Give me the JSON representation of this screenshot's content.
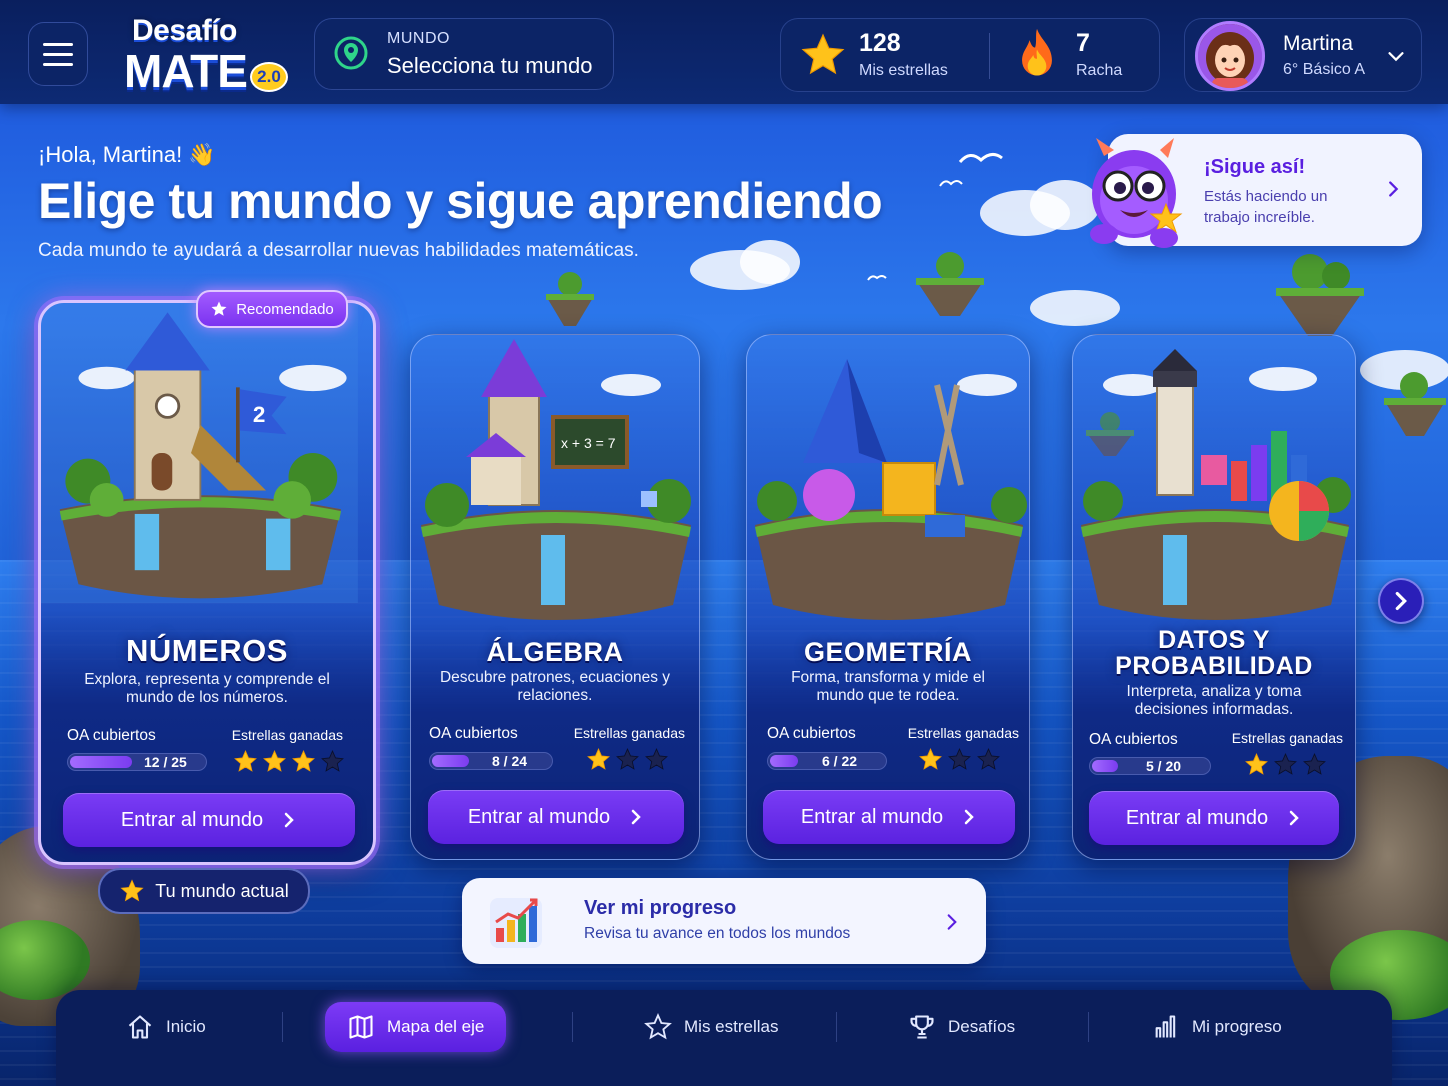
{
  "header": {
    "logo_line1": "Desafío",
    "logo_line2": "MATE",
    "logo_version": "2.0",
    "world_caption": "MUNDO",
    "world_value": "Selecciona tu mundo",
    "stars_count": "128",
    "stars_label": "Mis estrellas",
    "streak_count": "7",
    "streak_label": "Racha",
    "user_name": "Martina",
    "user_grade": "6° Básico A"
  },
  "greeting": {
    "hello": "¡Hola, Martina! 👋",
    "headline": "Elige tu mundo y sigue aprendiendo",
    "subtitle": "Cada mundo te ayudará a desarrollar nuevas habilidades matemáticas."
  },
  "cheer": {
    "title": "¡Sigue así!",
    "text": "Estás haciendo un trabajo increíble."
  },
  "labels": {
    "recommended": "Recomendado",
    "current_world": "Tu mundo actual",
    "oa_label": "OA cubiertos",
    "stars_label": "Estrellas ganadas",
    "enter": "Entrar al mundo"
  },
  "worlds": [
    {
      "title": "NÚMEROS",
      "desc": "Explora, representa y comprende el mundo de los números.",
      "oa": "12 / 25",
      "oa_fraction": 0.48,
      "stars": 3,
      "max_stars": 4
    },
    {
      "title": "ÁLGEBRA",
      "desc": "Descubre patrones, ecuaciones y relaciones.",
      "oa": "8 / 24",
      "oa_fraction": 0.333,
      "stars": 1,
      "max_stars": 3
    },
    {
      "title": "GEOMETRÍA",
      "desc": "Forma, transforma y mide el mundo que te rodea.",
      "oa": "6 / 22",
      "oa_fraction": 0.273,
      "stars": 1,
      "max_stars": 3
    },
    {
      "title": "DATOS Y PROBABILIDAD",
      "desc": "Interpreta, analiza y toma decisiones informadas.",
      "oa": "5 / 20",
      "oa_fraction": 0.25,
      "stars": 1,
      "max_stars": 3
    }
  ],
  "chalkboard": "x + 3 = 7",
  "flag_number": "2",
  "progress_banner": {
    "title": "Ver mi progreso",
    "subtitle": "Revisa tu avance en todos los mundos"
  },
  "nav": {
    "home": "Inicio",
    "map": "Mapa del eje",
    "stars": "Mis estrellas",
    "challenges": "Desafíos",
    "progress": "Mi progreso"
  },
  "colors": {
    "accent": "#6a2ef0",
    "star": "#ffc21a",
    "star_empty": "#1a2250"
  }
}
